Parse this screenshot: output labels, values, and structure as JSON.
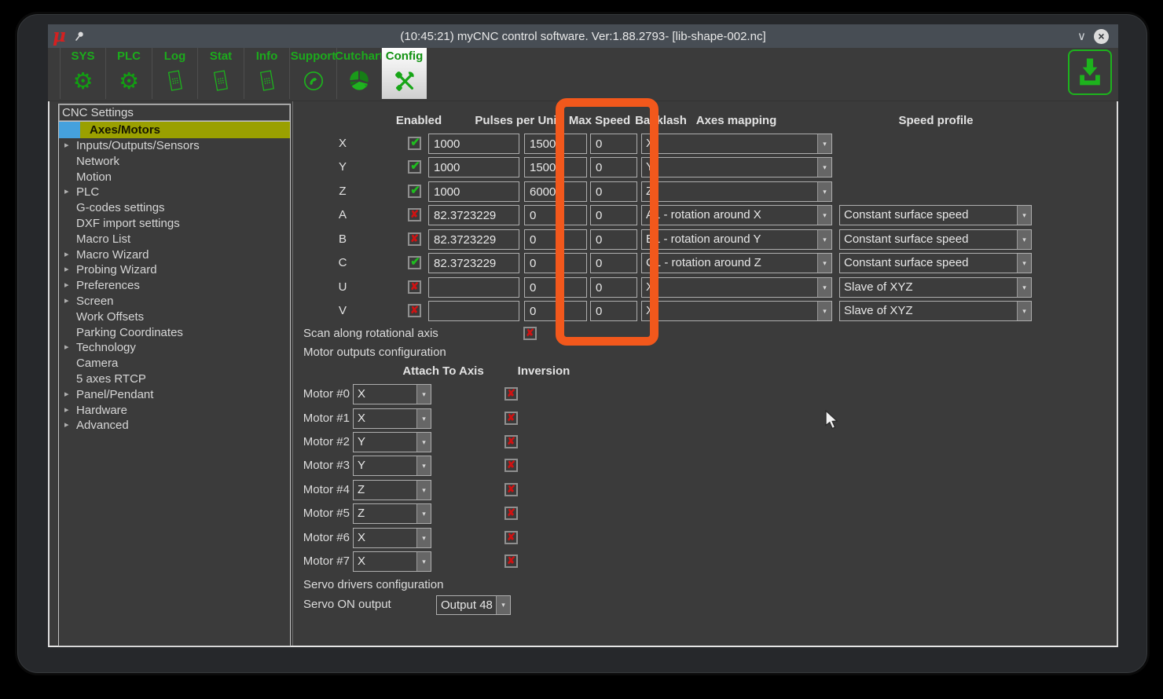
{
  "window": {
    "logo_glyph": "μ",
    "title": "(10:45:21) myCNC control software. Ver:1.88.2793- [lib-shape-002.nc]",
    "controls": {
      "shade_glyph": "∨",
      "close_glyph": "×"
    }
  },
  "toolbar": {
    "tabs": [
      {
        "label": "SYS",
        "icon": "gear-icon",
        "active": false
      },
      {
        "label": "PLC",
        "icon": "gear-icon",
        "active": false
      },
      {
        "label": "Log",
        "icon": "document-icon",
        "active": false
      },
      {
        "label": "Stat",
        "icon": "document-icon",
        "active": false
      },
      {
        "label": "Info",
        "icon": "document-icon",
        "active": false
      },
      {
        "label": "Support",
        "icon": "phone-icon",
        "active": false
      },
      {
        "label": "Cutchart",
        "icon": "pie-chart-icon",
        "active": false
      },
      {
        "label": "Config",
        "icon": "tools-icon",
        "active": true
      }
    ]
  },
  "icons": {
    "gear": "⚙",
    "caret_down": "▾",
    "expand_arrow": "▸",
    "check": "✔",
    "cross": "✘"
  },
  "sidebar": {
    "header": "CNC Settings",
    "items": [
      {
        "label": "Axes/Motors",
        "selected": true,
        "expandable": false
      },
      {
        "label": "Inputs/Outputs/Sensors",
        "expandable": true
      },
      {
        "label": "Network",
        "expandable": false
      },
      {
        "label": "Motion",
        "expandable": false
      },
      {
        "label": "PLC",
        "expandable": true
      },
      {
        "label": "G-codes settings",
        "expandable": false
      },
      {
        "label": "DXF import settings",
        "expandable": false
      },
      {
        "label": "Macro List",
        "expandable": false
      },
      {
        "label": "Macro Wizard",
        "expandable": true
      },
      {
        "label": "Probing Wizard",
        "expandable": true
      },
      {
        "label": "Preferences",
        "expandable": true
      },
      {
        "label": "Screen",
        "expandable": true
      },
      {
        "label": "Work Offsets",
        "expandable": false
      },
      {
        "label": "Parking Coordinates",
        "expandable": false
      },
      {
        "label": "Technology",
        "expandable": true
      },
      {
        "label": "Camera",
        "expandable": false
      },
      {
        "label": "5 axes RTCP",
        "expandable": false
      },
      {
        "label": "Panel/Pendant",
        "expandable": true
      },
      {
        "label": "Hardware",
        "expandable": true
      },
      {
        "label": "Advanced",
        "expandable": true
      }
    ]
  },
  "axes_table": {
    "headers": {
      "enabled": "Enabled",
      "pulses": "Pulses per Unit",
      "max_speed": "Max Speed",
      "backlash": "Backlash",
      "mapping": "Axes mapping",
      "speed_profile": "Speed profile"
    },
    "rows": [
      {
        "axis": "X",
        "enabled": true,
        "pulses": "1000",
        "max_speed": "15000",
        "backlash": "0",
        "mapping": "X"
      },
      {
        "axis": "Y",
        "enabled": true,
        "pulses": "1000",
        "max_speed": "15000",
        "backlash": "0",
        "mapping": "Y"
      },
      {
        "axis": "Z",
        "enabled": true,
        "pulses": "1000",
        "max_speed": "6000",
        "backlash": "0",
        "mapping": "Z"
      },
      {
        "axis": "A",
        "enabled": false,
        "pulses": "82.3723229",
        "max_speed": "0",
        "backlash": "0",
        "mapping": "A1 - rotation around X",
        "speed_profile": "Constant surface speed"
      },
      {
        "axis": "B",
        "enabled": false,
        "pulses": "82.3723229",
        "max_speed": "0",
        "backlash": "0",
        "mapping": "B1 - rotation around Y",
        "speed_profile": "Constant surface speed"
      },
      {
        "axis": "C",
        "enabled": true,
        "pulses": "82.3723229",
        "max_speed": "0",
        "backlash": "0",
        "mapping": "C1 - rotation around Z",
        "speed_profile": "Constant surface speed"
      },
      {
        "axis": "U",
        "enabled": false,
        "pulses": "",
        "max_speed": "0",
        "backlash": "0",
        "mapping": "X",
        "speed_profile": "Slave of XYZ"
      },
      {
        "axis": "V",
        "enabled": false,
        "pulses": "",
        "max_speed": "0",
        "backlash": "0",
        "mapping": "X",
        "speed_profile": "Slave of XYZ"
      }
    ],
    "scan_label": "Scan along rotational axis",
    "scan_checked": false
  },
  "motor_outputs": {
    "title": "Motor outputs configuration",
    "headers": {
      "attach": "Attach To Axis",
      "inversion": "Inversion"
    },
    "rows": [
      {
        "label": "Motor #0",
        "axis": "X",
        "inversion": false
      },
      {
        "label": "Motor #1",
        "axis": "X",
        "inversion": false
      },
      {
        "label": "Motor #2",
        "axis": "Y",
        "inversion": false
      },
      {
        "label": "Motor #3",
        "axis": "Y",
        "inversion": false
      },
      {
        "label": "Motor #4",
        "axis": "Z",
        "inversion": false
      },
      {
        "label": "Motor #5",
        "axis": "Z",
        "inversion": false
      },
      {
        "label": "Motor #6",
        "axis": "X",
        "inversion": false
      },
      {
        "label": "Motor #7",
        "axis": "X",
        "inversion": false
      }
    ]
  },
  "servo": {
    "title": "Servo drivers configuration",
    "label": "Servo ON output",
    "value": "Output 48"
  },
  "annotation": {
    "highlighted_column": "Backlash",
    "color": "#f2581c"
  },
  "colors": {
    "accent_green": "#1db31d",
    "titlebar": "#474d54",
    "panel_bg": "#3b3b3b",
    "selected_item": "#9aa000",
    "selection_marker": "#45a1dd",
    "check_green": "#1fbd1f",
    "cross_red": "#cf1212"
  }
}
